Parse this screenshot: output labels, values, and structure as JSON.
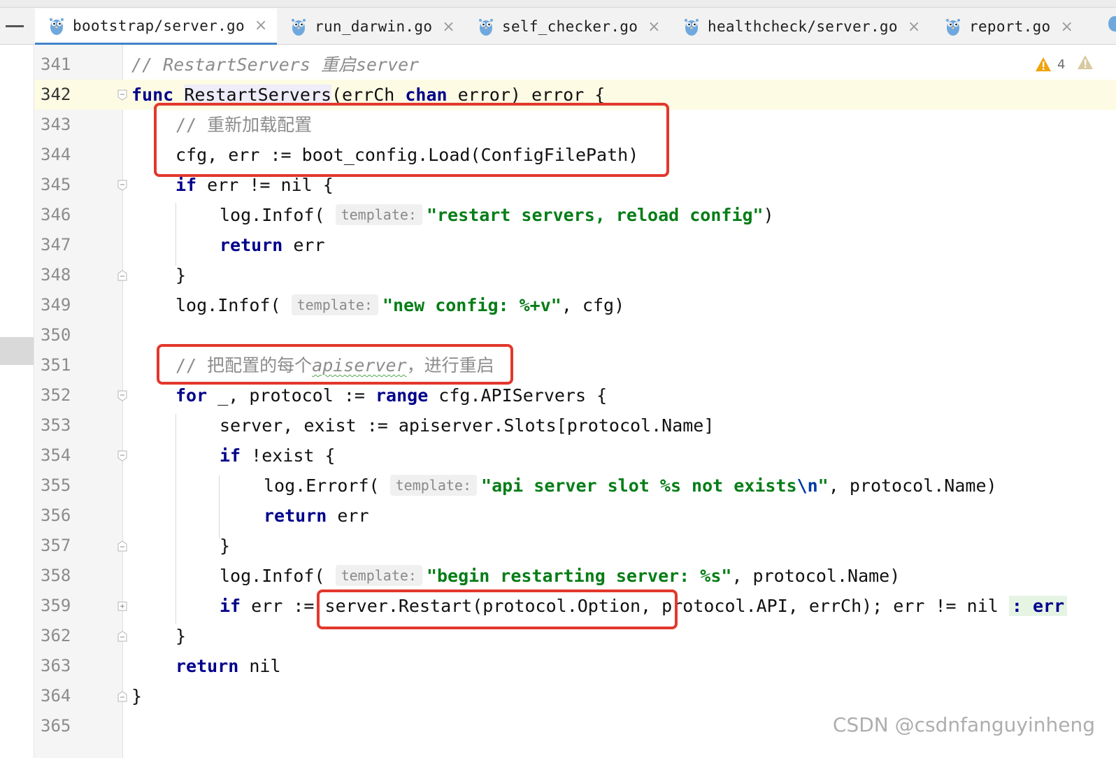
{
  "tabs": [
    {
      "label": "bootstrap/server.go",
      "active": true
    },
    {
      "label": "run_darwin.go",
      "active": false
    },
    {
      "label": "self_checker.go",
      "active": false
    },
    {
      "label": "healthcheck/server.go",
      "active": false
    },
    {
      "label": "report.go",
      "active": false
    }
  ],
  "close_glyph": "×",
  "inspections": {
    "warning_count": "4"
  },
  "hint_label": "template:",
  "lines": {
    "l341": {
      "num": "341",
      "comment": "// RestartServers 重启server"
    },
    "l342": {
      "num": "342",
      "kw_func": "func",
      "name": "RestartServers",
      "rest1": "(errCh ",
      "kw_chan": "chan",
      "rest2": " error) error {"
    },
    "l343": {
      "num": "343",
      "comment": "// 重新加载配置"
    },
    "l344": {
      "num": "344",
      "code": "cfg, err := boot_config.Load(ConfigFilePath)"
    },
    "l345": {
      "num": "345",
      "kw": "if",
      "rest": " err != nil {"
    },
    "l346": {
      "num": "346",
      "call": "log.Infof(",
      "str": "\"restart servers, reload config\"",
      "end": ")"
    },
    "l347": {
      "num": "347",
      "kw": "return",
      "rest": " err"
    },
    "l348": {
      "num": "348",
      "code": "}"
    },
    "l349": {
      "num": "349",
      "call": "log.Infof(",
      "str": "\"new config: %+v\"",
      "end": ", cfg)"
    },
    "l350": {
      "num": "350"
    },
    "l351": {
      "num": "351",
      "comment_a": "// 把配置的每个",
      "comment_b": "apiserver",
      "comment_c": "，进行重启"
    },
    "l352": {
      "num": "352",
      "kw": "for",
      "mid": " _, protocol := ",
      "kw2": "range",
      "rest": " cfg.APIServers {"
    },
    "l353": {
      "num": "353",
      "code": "server, exist := apiserver.Slots[protocol.Name]"
    },
    "l354": {
      "num": "354",
      "kw": "if",
      "rest": " !exist {"
    },
    "l355": {
      "num": "355",
      "call": "log.Errorf(",
      "str_a": "\"api server slot %s not exists",
      "esc": "\\n",
      "str_b": "\"",
      "end": ", protocol.Name)"
    },
    "l356": {
      "num": "356",
      "kw": "return",
      "rest": " err"
    },
    "l357": {
      "num": "357",
      "code": "}"
    },
    "l358": {
      "num": "358",
      "call": "log.Infof(",
      "str": "\"begin restarting server: %s\"",
      "end": ", protocol.Name)"
    },
    "l359": {
      "num": "359",
      "kw": "if",
      "rest": " err := server.Restart(protocol.Option, protocol.API, errCh); err != nil ",
      "folded": ": err"
    },
    "l362": {
      "num": "362",
      "code": "}"
    },
    "l363": {
      "num": "363",
      "kw": "return",
      "rest": " nil"
    },
    "l364": {
      "num": "364",
      "code": "}"
    },
    "l365": {
      "num": "365"
    }
  },
  "watermark": "CSDN @csdnfanguyinheng",
  "colors": {
    "keyword": "#00008b",
    "string": "#067d17",
    "comment": "#8c8c8c",
    "highlight_box": "#e2382c",
    "warning": "#f0a30a"
  }
}
